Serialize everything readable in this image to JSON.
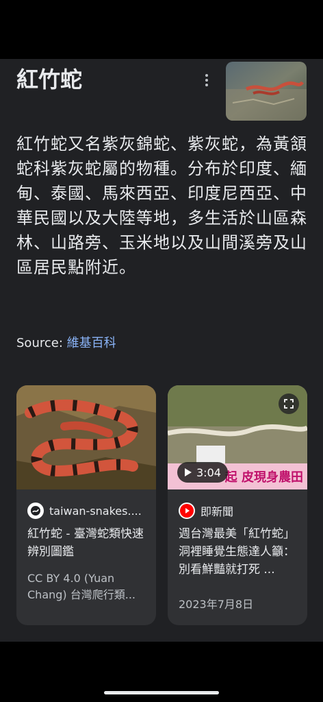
{
  "header": {
    "title": "紅竹蛇"
  },
  "description": "紅竹蛇又名紫灰錦蛇、紫灰蛇，為黃頷蛇科紫灰蛇屬的物種。分布於印度、緬甸、泰國、馬來西亞、印度尼西亞、中華民國以及大陸等地，多生活於山區森林、山路旁、玉米地以及山間溪旁及山區居民點附近。",
  "source": {
    "label": "Source:",
    "link_text": "維基百科"
  },
  "cards": [
    {
      "site_name": "taiwan-snakes....",
      "title": "紅竹蛇 - 臺灣蛇類快速辨別圖鑑",
      "meta": "CC BY 4.0 (Yuan Chang) 台灣爬行類..."
    },
    {
      "site_name": "即新聞",
      "title": "週台灣最美「紅竹蛇」洞裡睡覺生態達人籲：別看鮮豔就打死 ...",
      "meta": "2023年7月8日",
      "video_duration": "3:04",
      "overlay_text": "起 皮現身農田"
    }
  ],
  "colors": {
    "panel_bg": "#202124",
    "card_bg": "#303134",
    "link": "#8ab4f8",
    "text": "#e8eaed",
    "secondary_text": "#bdc1c6"
  }
}
